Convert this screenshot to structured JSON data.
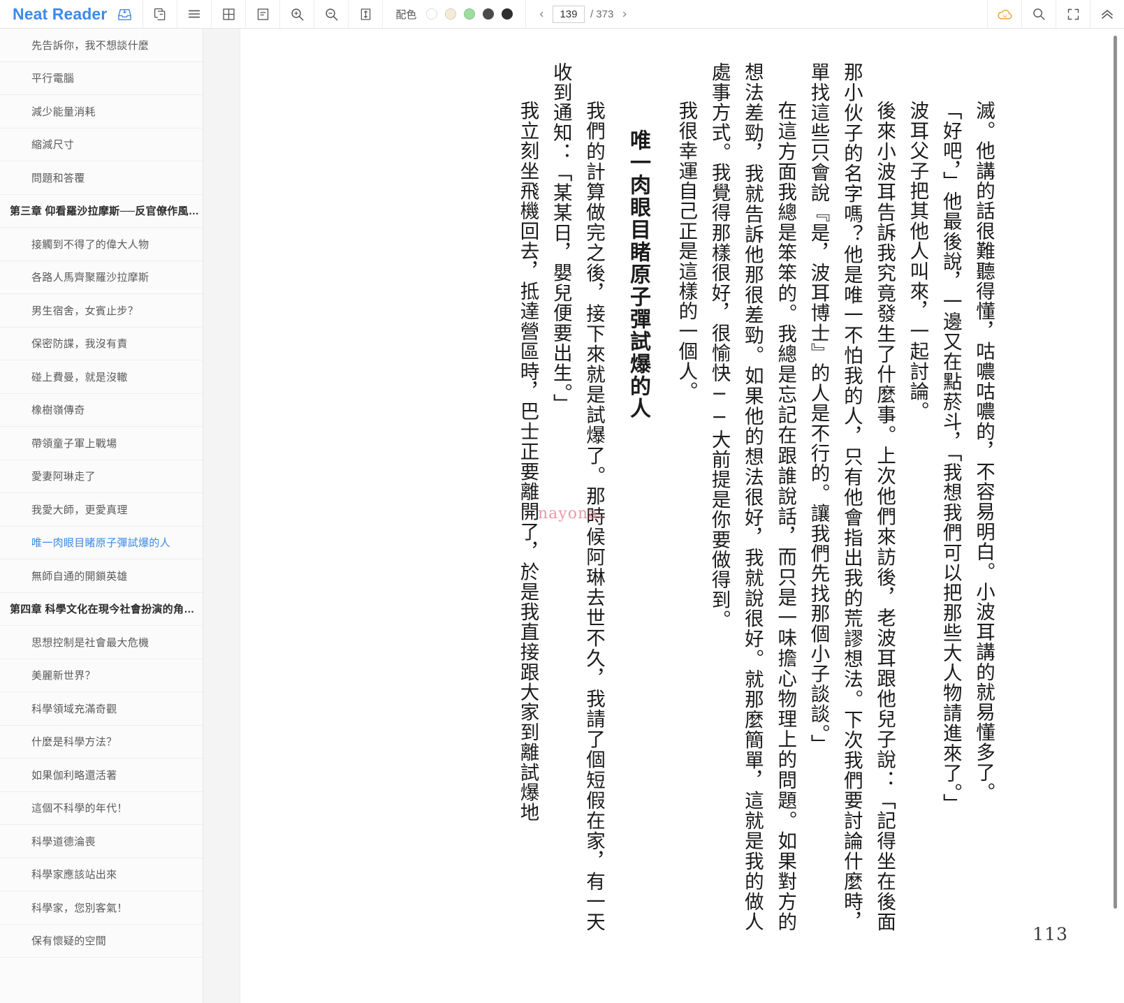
{
  "app": {
    "brand": "Neat Reader"
  },
  "toolbar": {
    "icons": [
      {
        "name": "save-to-library-icon",
        "glyph": "tray-download"
      },
      {
        "name": "copy-icon",
        "glyph": "copy"
      },
      {
        "name": "list-view-icon",
        "glyph": "hamburger"
      },
      {
        "name": "grid-view-icon",
        "glyph": "grid"
      },
      {
        "name": "notes-icon",
        "glyph": "note"
      },
      {
        "name": "zoom-in-icon",
        "glyph": "magnify-plus"
      },
      {
        "name": "zoom-out-icon",
        "glyph": "magnify-minus"
      },
      {
        "name": "line-height-icon",
        "glyph": "updown-arrow-box"
      }
    ],
    "color_label": "配色",
    "color_swatches": [
      "#ffffff",
      "#f5ecd8",
      "#9fdca0",
      "#4a4a4a",
      "#2e2e2e"
    ],
    "prev_label": "‹",
    "next_label": "›",
    "page_current": "139",
    "page_total": "/ 373",
    "right_icons": [
      {
        "name": "cloud-sync-icon",
        "glyph": "cloud",
        "color": "#e6a23c"
      },
      {
        "name": "search-icon",
        "glyph": "magnify"
      },
      {
        "name": "fullscreen-icon",
        "glyph": "expand"
      },
      {
        "name": "collapse-toolbar-icon",
        "glyph": "chevron-double-up"
      }
    ]
  },
  "sidebar": {
    "items": [
      {
        "label": "先告訴你，我不想談什麼",
        "type": "section",
        "active": false
      },
      {
        "label": "平行電腦",
        "type": "section",
        "active": false
      },
      {
        "label": "減少能量消耗",
        "type": "section",
        "active": false
      },
      {
        "label": "縮減尺寸",
        "type": "section",
        "active": false
      },
      {
        "label": "問題和答覆",
        "type": "section",
        "active": false
      },
      {
        "label": "第三章 仰看羅沙拉摩斯──反官僚作風…",
        "type": "chapter",
        "active": false
      },
      {
        "label": "接觸到不得了的偉大人物",
        "type": "section",
        "active": false
      },
      {
        "label": "各路人馬齊聚羅沙拉摩斯",
        "type": "section",
        "active": false
      },
      {
        "label": "男生宿舍，女賓止步？",
        "type": "section",
        "active": false
      },
      {
        "label": "保密防諜，我沒有責",
        "type": "section",
        "active": false
      },
      {
        "label": "碰上費曼，就是沒轍",
        "type": "section",
        "active": false
      },
      {
        "label": "橡樹嶺傳奇",
        "type": "section",
        "active": false
      },
      {
        "label": "帶領童子軍上戰場",
        "type": "section",
        "active": false
      },
      {
        "label": "愛妻阿琳走了",
        "type": "section",
        "active": false
      },
      {
        "label": "我愛大師，更愛真理",
        "type": "section",
        "active": false
      },
      {
        "label": "唯一肉眼目睹原子彈試爆的人",
        "type": "section",
        "active": true
      },
      {
        "label": "無師自通的開鎖英雄",
        "type": "section",
        "active": false
      },
      {
        "label": "第四章 科學文化在現今社會扮演的角…",
        "type": "chapter",
        "active": false
      },
      {
        "label": "思想控制是社會最大危機",
        "type": "section",
        "active": false
      },
      {
        "label": "美麗新世界？",
        "type": "section",
        "active": false
      },
      {
        "label": "科學領域充滿奇觀",
        "type": "section",
        "active": false
      },
      {
        "label": "什麼是科學方法？",
        "type": "section",
        "active": false
      },
      {
        "label": "如果伽利略還活著",
        "type": "section",
        "active": false
      },
      {
        "label": "這個不科學的年代！",
        "type": "section",
        "active": false
      },
      {
        "label": "科學道德淪喪",
        "type": "section",
        "active": false
      },
      {
        "label": "科學家應該站出來",
        "type": "section",
        "active": false
      },
      {
        "label": "科學家，您別客氣！",
        "type": "section",
        "active": false
      },
      {
        "label": "保有懷疑的空間",
        "type": "section",
        "active": false
      }
    ]
  },
  "content": {
    "para1": "滅。他講的話很難聽得懂，咕噥咕噥的，不容易明白。小波耳講的就易懂多了。",
    "para2": "「好吧，」他最後說，一邊又在點菸斗，「我想我們可以把那些大人物請進來了。」",
    "para3": "波耳父子把其他人叫來，一起討論。",
    "para4": "後來小波耳告訴我究竟發生了什麼事。上次他們來訪後，老波耳跟他兒子說：「記得坐在後面那小伙子的名字嗎？他是唯一不怕我的人，只有他會指出我的荒謬想法。下次我們要討論什麼時，單找這些只會說『是，波耳博士』的人是不行的。讓我們先找那個小子談談。」",
    "para5": "在這方面我總是笨笨的。我總是忘記在跟誰說話，而只是一味擔心物理上的問題。如果對方的想法差勁，我就告訴他那很差勁。如果他的想法很好，我就說很好。就那麼簡單，這就是我的做人處事方式。我覺得那樣很好，很愉快──大前提是你要做得到。",
    "para6": "我很幸運自己正是這樣的一個人。",
    "heading": "唯一肉眼目睹原子彈試爆的人",
    "para7": "我們的計算做完之後，接下來就是試爆了。那時候阿琳去世不久，我請了個短假在家，有一天收到通知：「某某日，嬰兒便要出生。」",
    "para8": "我立刻坐飛機回去，抵達營區時，巴士正要離開了，於是我直接跟大家到離試爆地",
    "watermark": "nayona.",
    "page_number": "113"
  }
}
